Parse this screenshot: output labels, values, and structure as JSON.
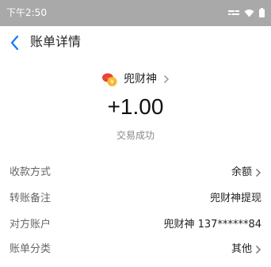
{
  "status_bar": {
    "time": "下午2:50",
    "icons": [
      "signal-icon",
      "wifi-icon",
      "battery-icon"
    ]
  },
  "nav": {
    "title": "账单详情",
    "back_icon": "chevron-left-icon"
  },
  "merchant": {
    "name": "兜财神",
    "logo_icon": "merchant-logo-icon"
  },
  "transaction": {
    "amount": "+1.00",
    "status": "交易成功"
  },
  "details": [
    {
      "label": "收款方式",
      "value": "余额",
      "has_chevron": true
    },
    {
      "label": "转账备注",
      "value": "兜财神提现",
      "has_chevron": false
    },
    {
      "label": "对方账户",
      "value": "兜财神 137******84",
      "has_chevron": false
    },
    {
      "label": "账单分类",
      "value": "其他",
      "has_chevron": true
    }
  ],
  "colors": {
    "status_bar_bg": "#a9a9a9",
    "accent_blue": "#1677ff",
    "label_gray": "#666666",
    "secondary_gray": "#888888"
  }
}
